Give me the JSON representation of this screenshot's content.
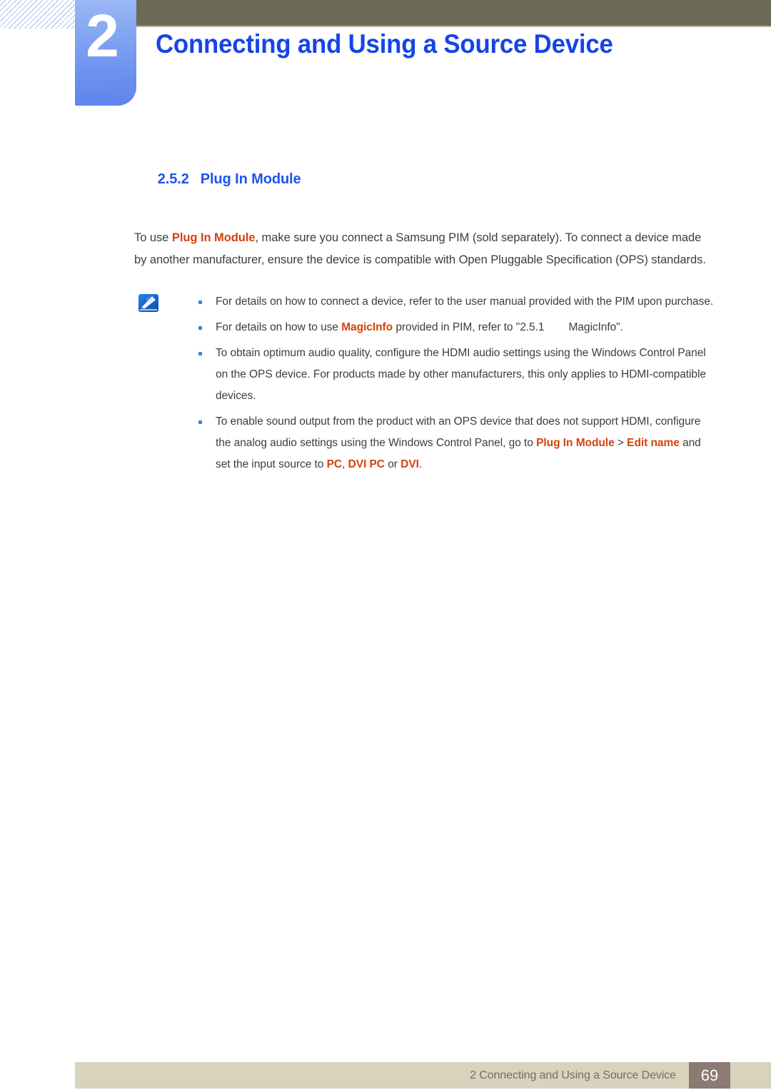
{
  "chapter": {
    "number": "2",
    "title": "Connecting and Using a Source Device"
  },
  "section": {
    "number": "2.5.2",
    "title": "Plug In Module"
  },
  "intro": {
    "p1_a": "To use ",
    "p1_hl": "Plug In Module",
    "p1_b": ", make sure you connect a Samsung PIM (sold separately). To connect a device made by another manufacturer, ensure the device is compatible with Open Pluggable Specification (OPS) standards."
  },
  "note": {
    "icon": "note-pen-icon",
    "bullets": [
      {
        "parts": [
          {
            "text": "For details on how to connect a device, refer to the user manual provided with the PIM upon purchase.",
            "style": "normal"
          }
        ]
      },
      {
        "parts": [
          {
            "text": "For details on how to use ",
            "style": "normal"
          },
          {
            "text": "MagicInfo",
            "style": "highlight"
          },
          {
            "text": " provided in PIM, refer to \"2.5.1",
            "style": "normal"
          },
          {
            "text": "",
            "style": "tab"
          },
          {
            "text": "MagicInfo\".",
            "style": "normal"
          }
        ]
      },
      {
        "parts": [
          {
            "text": "To obtain optimum audio quality, configure the HDMI audio settings using the Windows Control Panel on the OPS device. For products made by other manufacturers, this only applies to HDMI-compatible devices.",
            "style": "normal"
          }
        ]
      },
      {
        "parts": [
          {
            "text": "To enable sound output from the product with an OPS device that does not support HDMI, configure the analog audio settings using the Windows Control Panel, go to ",
            "style": "normal"
          },
          {
            "text": "Plug In Module",
            "style": "highlight"
          },
          {
            "text": " > ",
            "style": "normal"
          },
          {
            "text": "Edit name",
            "style": "highlight"
          },
          {
            "text": " and set the input source to ",
            "style": "normal"
          },
          {
            "text": "PC",
            "style": "highlight"
          },
          {
            "text": ", ",
            "style": "normal"
          },
          {
            "text": "DVI PC",
            "style": "highlight"
          },
          {
            "text": " or ",
            "style": "normal"
          },
          {
            "text": "DVI",
            "style": "highlight"
          },
          {
            "text": ".",
            "style": "normal"
          }
        ]
      }
    ]
  },
  "footer": {
    "text": "2 Connecting and Using a Source Device",
    "page_number": "69"
  },
  "colors": {
    "title_blue": "#1644e8",
    "heading_blue": "#1c55e8",
    "highlight_orange": "#d4420c",
    "header_bar": "#6d6b56",
    "chapter_block": "#6e94ef",
    "footer_bar": "#d8d3bd",
    "page_num_box": "#8d7a72",
    "body_text": "#3d3d3d"
  }
}
